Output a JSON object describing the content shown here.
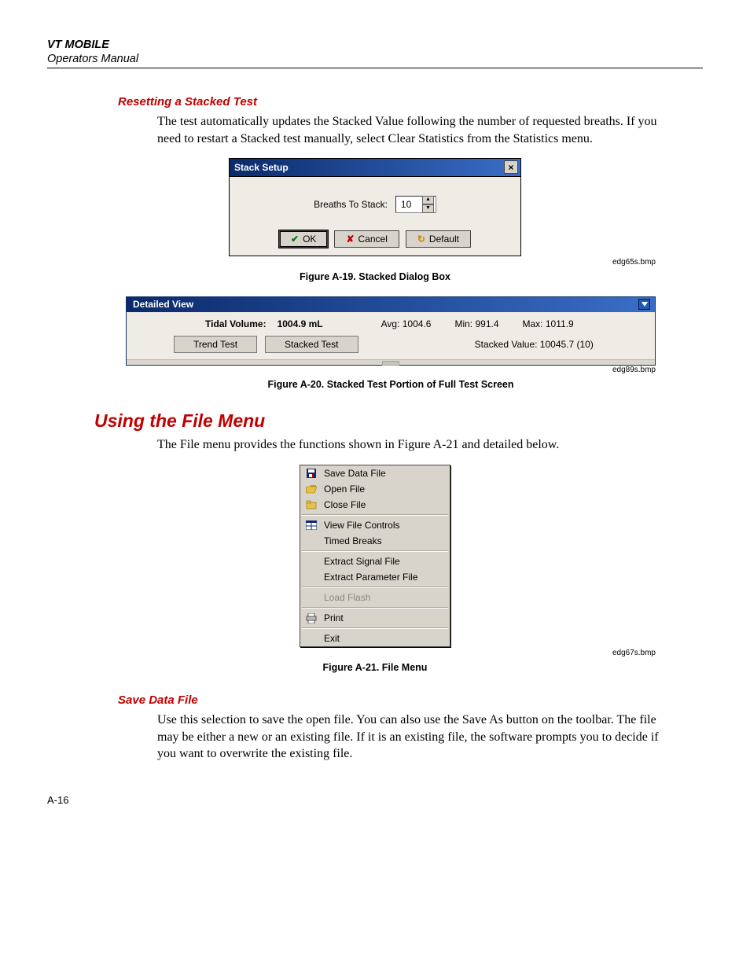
{
  "header": {
    "title": "VT MOBILE",
    "subtitle": "Operators Manual"
  },
  "section1": {
    "heading": "Resetting a Stacked Test",
    "para": "The test automatically updates the Stacked Value following the number of requested breaths. If you need to restart a Stacked test manually, select Clear Statistics from the Statistics menu."
  },
  "dialog1": {
    "title": "Stack Setup",
    "field_label": "Breaths To Stack:",
    "field_value": "10",
    "ok": "OK",
    "cancel": "Cancel",
    "default": "Default"
  },
  "fig19": {
    "caption": "Figure A-19. Stacked Dialog Box",
    "file": "edg65s.bmp"
  },
  "detview": {
    "title": "Detailed View",
    "tidal_label": "Tidal Volume:",
    "tidal_value": "1004.9 mL",
    "avg": "Avg:  1004.6",
    "min": "Min:  991.4",
    "max": "Max:  1011.9",
    "trend_btn": "Trend Test",
    "stacked_btn": "Stacked Test",
    "stacked_value": "Stacked Value:  10045.7    (10)"
  },
  "fig20": {
    "caption": "Figure A-20. Stacked Test Portion of Full Test Screen",
    "file": "edg89s.bmp"
  },
  "section2": {
    "heading": "Using the File Menu",
    "para": "The File menu provides the functions shown in Figure A-21 and detailed below."
  },
  "menu": {
    "save": "Save Data File",
    "open": "Open File",
    "close": "Close File",
    "viewctrl": "View File Controls",
    "timed": "Timed Breaks",
    "extract_sig": "Extract Signal File",
    "extract_par": "Extract Parameter File",
    "load_flash": "Load Flash",
    "print": "Print",
    "exit": "Exit"
  },
  "fig21": {
    "caption": "Figure A-21. File Menu",
    "file": "edg67s.bmp"
  },
  "section3": {
    "heading": "Save Data File",
    "para": "Use this selection to save the open file. You can also use the Save As button on the toolbar. The file may be either a new or an existing file. If it is an existing file, the software prompts you to decide if you want to overwrite the existing file."
  },
  "page_number": "A-16"
}
